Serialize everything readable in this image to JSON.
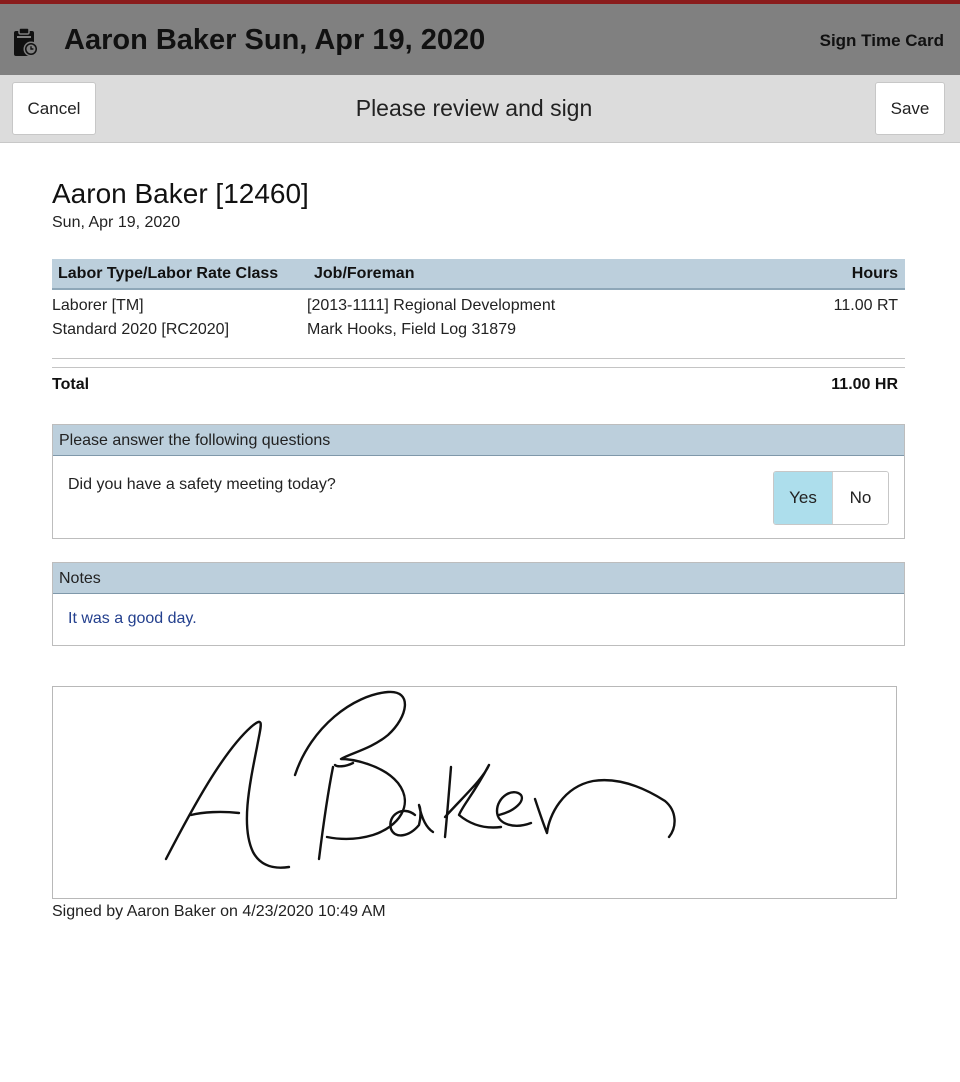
{
  "header": {
    "title": "Aaron Baker Sun, Apr 19, 2020",
    "sign_button": "Sign Time Card",
    "icon": "clipboard-clock-icon"
  },
  "subheader": {
    "cancel_label": "Cancel",
    "heading": "Please review and sign",
    "save_label": "Save"
  },
  "employee": {
    "name": "Aaron Baker [12460]",
    "date": "Sun, Apr 19, 2020"
  },
  "table": {
    "columns": [
      "Labor Type/Labor Rate Class",
      "Job/Foreman",
      "Hours"
    ],
    "rows": [
      {
        "labor_type": "Laborer [TM]",
        "rate_class": "Standard 2020 [RC2020]",
        "job": "[2013-1111] Regional Development",
        "foreman": "Mark Hooks, Field Log 31879",
        "hours": "11.00 RT"
      }
    ],
    "total_label": "Total",
    "total_value": "11.00 HR"
  },
  "questions": {
    "heading": "Please answer the following questions",
    "items": [
      {
        "text": "Did you have a safety meeting today?",
        "yes_label": "Yes",
        "no_label": "No",
        "selected": "Yes"
      }
    ]
  },
  "notes": {
    "heading": "Notes",
    "text": "It was a good day."
  },
  "signature": {
    "caption": "Signed by Aaron Baker on 4/23/2020 10:49 AM"
  },
  "colors": {
    "topbar": "#808080",
    "accent_border": "#8a1c1c",
    "table_header": "#bccfdc",
    "toggle_selected": "#addeec",
    "note_text": "#24408e"
  }
}
